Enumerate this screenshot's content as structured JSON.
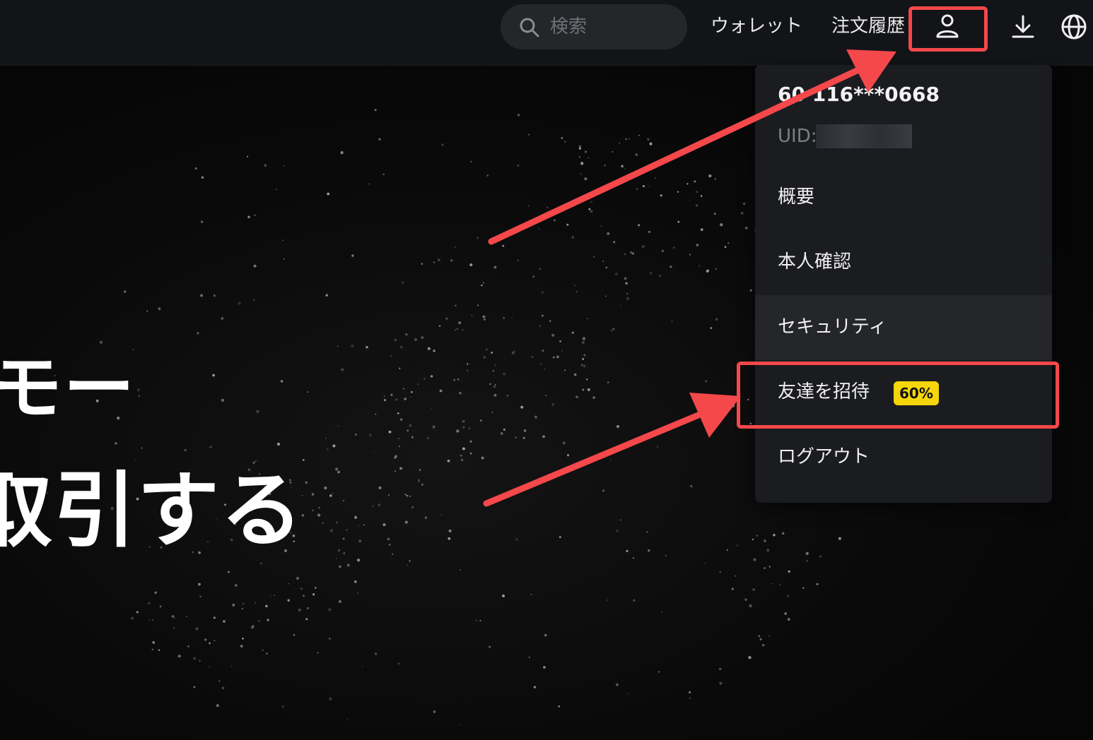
{
  "header": {
    "search": {
      "placeholder": "検索",
      "icon": "search-icon"
    },
    "nav": [
      {
        "label": "ウォレット"
      },
      {
        "label": "注文履歴"
      }
    ],
    "icons": [
      "user-icon",
      "download-icon",
      "globe-icon"
    ]
  },
  "hero": {
    "line1": "モー",
    "line2": "取引する"
  },
  "account_menu": {
    "account_id": "60 116***0668",
    "uid_label": "UID:",
    "items": [
      {
        "label": "概要"
      },
      {
        "label": "本人確認"
      },
      {
        "label": "セキュリティ"
      },
      {
        "label": "友達を招待",
        "badge": "60%"
      },
      {
        "label": "ログアウト"
      }
    ]
  },
  "colors": {
    "annotation": "#f4484b",
    "badge": "#f5d60a",
    "topbar": "#131417",
    "menu": "#1b1c20"
  }
}
